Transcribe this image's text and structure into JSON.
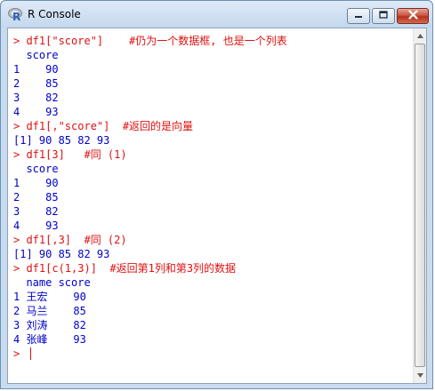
{
  "window": {
    "title": "R Console",
    "app_icon": "r-logo-icon",
    "controls": [
      "minimize-icon",
      "maximize-icon",
      "close-icon"
    ],
    "close_color": "#c0412f"
  },
  "console": {
    "input_color": "#e01010",
    "output_color": "#0000cc",
    "lines": [
      {
        "kind": "input",
        "text": "> df1[\"score\"]    #仍为一个数据框, 也是一个列表"
      },
      {
        "kind": "output",
        "text": "  score"
      },
      {
        "kind": "output",
        "text": "1    90"
      },
      {
        "kind": "output",
        "text": "2    85"
      },
      {
        "kind": "output",
        "text": "3    82"
      },
      {
        "kind": "output",
        "text": "4    93"
      },
      {
        "kind": "input",
        "text": "> df1[,\"score\"]  #返回的是向量"
      },
      {
        "kind": "output",
        "text": "[1] 90 85 82 93"
      },
      {
        "kind": "input",
        "text": "> df1[3]   #同 (1)"
      },
      {
        "kind": "output",
        "text": "  score"
      },
      {
        "kind": "output",
        "text": "1    90"
      },
      {
        "kind": "output",
        "text": "2    85"
      },
      {
        "kind": "output",
        "text": "3    82"
      },
      {
        "kind": "output",
        "text": "4    93"
      },
      {
        "kind": "input",
        "text": "> df1[,3]  #同 (2)"
      },
      {
        "kind": "output",
        "text": "[1] 90 85 82 93"
      },
      {
        "kind": "input",
        "text": "> df1[c(1,3)]  #返回第1列和第3列的数据"
      },
      {
        "kind": "output",
        "text": "  name score"
      },
      {
        "kind": "output",
        "text": "1 王宏    90"
      },
      {
        "kind": "output",
        "text": "2 马兰    85"
      },
      {
        "kind": "output",
        "text": "3 刘涛    82"
      },
      {
        "kind": "output",
        "text": "4 张峰    93"
      },
      {
        "kind": "input",
        "text": "> "
      }
    ]
  }
}
